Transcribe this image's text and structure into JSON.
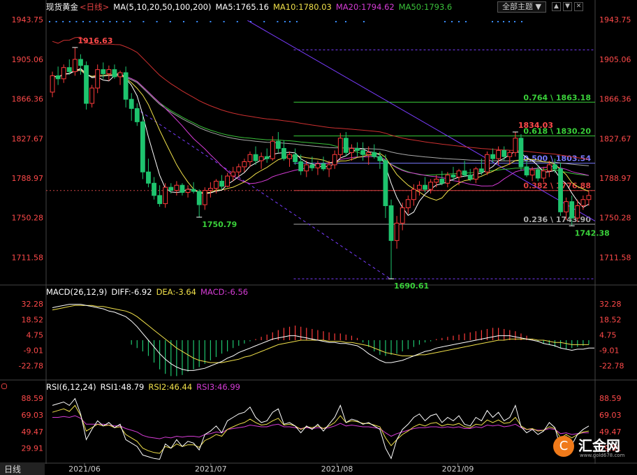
{
  "header": {
    "title": "现货黄金",
    "period": "<日线>",
    "ma_label": "MA(5,10,20,50,100,200)",
    "ma5": "MA5:1765.16",
    "ma10": "MA10:1780.03",
    "ma20": "MA20:1794.62",
    "ma50": "MA50:1793.6",
    "theme_button": "全部主题",
    "theme_arrow": "▼",
    "controls": [
      "▲",
      "▼",
      "✕"
    ]
  },
  "macd_header": {
    "label": "MACD(26,12,9)",
    "diff": "DIFF:-6.92",
    "dea": "DEA:-3.64",
    "macd": "MACD:-6.56"
  },
  "rsi_header": {
    "label": "RSI(6,12,24)",
    "rsi1": "RSI1:48.79",
    "rsi2": "RSI2:46.44",
    "rsi3": "RSI3:46.99"
  },
  "bottom_tab": "日线",
  "logo": {
    "text": "汇金网",
    "url": "www.gold678.com"
  },
  "colors": {
    "up": "#ff3b3b",
    "down": "#1ec46e",
    "ma5": "#ffffff",
    "ma10": "#f0e04a",
    "ma20": "#d63cd6",
    "ma50": "#3ac23a",
    "ma100": "#cc3030",
    "ma200": "#aaaaaa",
    "axis_text": "#ff4a4a",
    "trend": "#7a3cff"
  },
  "chart_data": [
    {
      "type": "candlestick",
      "title": "现货黄金 日线",
      "y_ticks": [
        "1943.75",
        "1905.06",
        "1866.36",
        "1827.67",
        "1788.97",
        "1750.28",
        "1711.58"
      ],
      "ylim": [
        1690,
        1948
      ],
      "x_ticks": [
        "2021/06",
        "2021/07",
        "2021/08",
        "2021/09"
      ],
      "candles": [
        [
          1873,
          1893,
          1868,
          1889
        ],
        [
          1889,
          1898,
          1880,
          1886
        ],
        [
          1886,
          1900,
          1882,
          1897
        ],
        [
          1897,
          1905,
          1890,
          1893
        ],
        [
          1893,
          1916.63,
          1889,
          1905
        ],
        [
          1905,
          1910,
          1890,
          1899
        ],
        [
          1899,
          1903,
          1856,
          1862
        ],
        [
          1862,
          1880,
          1858,
          1877
        ],
        [
          1877,
          1900,
          1872,
          1895
        ],
        [
          1895,
          1902,
          1886,
          1891
        ],
        [
          1891,
          1899,
          1884,
          1895
        ],
        [
          1895,
          1900,
          1886,
          1888
        ],
        [
          1888,
          1894,
          1880,
          1892
        ],
        [
          1892,
          1898,
          1858,
          1866
        ],
        [
          1866,
          1872,
          1845,
          1857
        ],
        [
          1857,
          1862,
          1840,
          1844
        ],
        [
          1844,
          1850,
          1788,
          1795
        ],
        [
          1795,
          1808,
          1780,
          1784
        ],
        [
          1784,
          1790,
          1768,
          1772
        ],
        [
          1772,
          1782,
          1761,
          1764
        ],
        [
          1764,
          1784,
          1760,
          1780
        ],
        [
          1780,
          1784,
          1774,
          1777
        ],
        [
          1777,
          1786,
          1772,
          1782
        ],
        [
          1782,
          1784,
          1772,
          1775
        ],
        [
          1775,
          1782,
          1770,
          1778
        ],
        [
          1778,
          1785,
          1774,
          1776
        ],
        [
          1776,
          1778,
          1750.79,
          1763
        ],
        [
          1763,
          1780,
          1758,
          1777
        ],
        [
          1777,
          1785,
          1770,
          1779
        ],
        [
          1779,
          1788,
          1774,
          1786
        ],
        [
          1786,
          1792,
          1778,
          1781
        ],
        [
          1781,
          1794,
          1780,
          1791
        ],
        [
          1791,
          1800,
          1786,
          1795
        ],
        [
          1795,
          1803,
          1790,
          1800
        ],
        [
          1800,
          1808,
          1795,
          1805
        ],
        [
          1805,
          1815,
          1800,
          1812
        ],
        [
          1812,
          1820,
          1802,
          1806
        ],
        [
          1806,
          1814,
          1798,
          1810
        ],
        [
          1810,
          1818,
          1804,
          1808
        ],
        [
          1808,
          1830,
          1806,
          1825
        ],
        [
          1825,
          1834,
          1814,
          1818
        ],
        [
          1818,
          1826,
          1806,
          1808
        ],
        [
          1808,
          1815,
          1800,
          1812
        ],
        [
          1812,
          1818,
          1802,
          1805
        ],
        [
          1805,
          1812,
          1792,
          1796
        ],
        [
          1796,
          1806,
          1790,
          1802
        ],
        [
          1802,
          1810,
          1796,
          1799
        ],
        [
          1799,
          1806,
          1792,
          1803
        ],
        [
          1803,
          1810,
          1796,
          1798
        ],
        [
          1798,
          1806,
          1790,
          1802
        ],
        [
          1802,
          1816,
          1798,
          1812
        ],
        [
          1812,
          1833,
          1808,
          1828
        ],
        [
          1828,
          1834,
          1810,
          1814
        ],
        [
          1814,
          1822,
          1806,
          1818
        ],
        [
          1818,
          1824,
          1810,
          1816
        ],
        [
          1816,
          1824,
          1806,
          1812
        ],
        [
          1812,
          1820,
          1802,
          1814
        ],
        [
          1814,
          1822,
          1808,
          1810
        ],
        [
          1810,
          1815,
          1798,
          1806
        ],
        [
          1806,
          1812,
          1750,
          1762
        ],
        [
          1762,
          1768,
          1690.61,
          1728
        ],
        [
          1728,
          1752,
          1720,
          1745
        ],
        [
          1745,
          1765,
          1738,
          1760
        ],
        [
          1760,
          1772,
          1754,
          1768
        ],
        [
          1768,
          1783,
          1762,
          1778
        ],
        [
          1778,
          1786,
          1772,
          1782
        ],
        [
          1782,
          1790,
          1775,
          1778
        ],
        [
          1778,
          1788,
          1774,
          1785
        ],
        [
          1785,
          1792,
          1780,
          1788
        ],
        [
          1788,
          1796,
          1782,
          1784
        ],
        [
          1784,
          1795,
          1780,
          1792
        ],
        [
          1792,
          1800,
          1786,
          1790
        ],
        [
          1790,
          1798,
          1782,
          1796
        ],
        [
          1796,
          1806,
          1790,
          1792
        ],
        [
          1792,
          1798,
          1786,
          1788
        ],
        [
          1788,
          1800,
          1784,
          1798
        ],
        [
          1798,
          1808,
          1792,
          1795
        ],
        [
          1795,
          1815,
          1792,
          1812
        ],
        [
          1812,
          1818,
          1804,
          1808
        ],
        [
          1808,
          1820,
          1802,
          1816
        ],
        [
          1816,
          1820,
          1806,
          1810
        ],
        [
          1810,
          1816,
          1802,
          1814
        ],
        [
          1814,
          1834.03,
          1810,
          1828
        ],
        [
          1828,
          1832,
          1796,
          1800
        ],
        [
          1800,
          1806,
          1790,
          1792
        ],
        [
          1792,
          1800,
          1786,
          1797
        ],
        [
          1797,
          1802,
          1786,
          1789
        ],
        [
          1789,
          1800,
          1785,
          1796
        ],
        [
          1796,
          1806,
          1790,
          1802
        ],
        [
          1802,
          1808,
          1794,
          1798
        ],
        [
          1798,
          1804,
          1752,
          1756
        ],
        [
          1756,
          1770,
          1748,
          1766
        ],
        [
          1766,
          1772,
          1742.38,
          1750
        ],
        [
          1750,
          1768,
          1746,
          1762
        ],
        [
          1762,
          1772,
          1758,
          1768
        ],
        [
          1768,
          1776,
          1762,
          1772
        ]
      ],
      "annotations": [
        "1916.63",
        "1750.79",
        "1690.61",
        "1834.03",
        "1742.38"
      ],
      "fibonacci": [
        {
          "label": "0.764 \\ 1863.18",
          "value": 1863.18,
          "color": "#3ad13a"
        },
        {
          "label": "0.618 \\ 1830.20",
          "value": 1830.2,
          "color": "#3ad13a"
        },
        {
          "label": "0.500 \\ 1803.54",
          "value": 1803.54,
          "color": "#7a7aff"
        },
        {
          "label": "0.382 \\ 1776.88",
          "value": 1776.88,
          "color": "#e04040"
        },
        {
          "label": "0.236 \\ 1743.90",
          "value": 1743.9,
          "color": "#aaaaaa"
        }
      ],
      "fib_extra_levels": [
        1914.3,
        1690.61
      ]
    },
    {
      "type": "macd",
      "y_ticks": [
        "32.28",
        "18.52",
        "4.75",
        "-9.01",
        "-22.78"
      ],
      "ylim": [
        -33,
        38
      ],
      "histogram": [
        0,
        0,
        0,
        0,
        0,
        0,
        0,
        0,
        0,
        0,
        0,
        0,
        0,
        0,
        -4,
        -7,
        -10,
        -14,
        -20,
        -26,
        -30,
        -32,
        -32,
        -31,
        -28,
        -26,
        -24,
        -21,
        -18,
        -15,
        -12,
        -10,
        -7,
        -5,
        -3,
        -1,
        1,
        3,
        5,
        7,
        9,
        11,
        12,
        13,
        12,
        11,
        10,
        9,
        8,
        7,
        6,
        6,
        5,
        4,
        2,
        -2,
        -6,
        -10,
        -13,
        -14,
        -13,
        -12,
        -10,
        -8,
        -6,
        -4,
        -2,
        -1,
        1,
        2,
        3,
        4,
        5,
        6,
        7,
        8,
        9,
        10,
        11,
        11,
        10,
        9,
        8,
        6,
        4,
        1,
        -1,
        -3,
        -4,
        -6,
        -7,
        -8,
        -7,
        -6,
        -5,
        -4
      ],
      "diff": [
        29,
        30,
        31,
        32,
        32,
        32,
        31,
        30,
        29,
        28,
        26,
        25,
        23,
        21,
        17,
        12,
        6,
        0,
        -6,
        -12,
        -17,
        -21,
        -24,
        -26,
        -27,
        -27,
        -26,
        -25,
        -23,
        -21,
        -19,
        -16,
        -14,
        -11,
        -9,
        -7,
        -5,
        -3,
        -1,
        1,
        2,
        3,
        4,
        4,
        3,
        2,
        1,
        0,
        -1,
        -2,
        -2,
        -3,
        -3,
        -4,
        -5,
        -8,
        -12,
        -15,
        -18,
        -20,
        -20,
        -19,
        -18,
        -16,
        -14,
        -12,
        -10,
        -9,
        -7,
        -6,
        -5,
        -4,
        -3,
        -2,
        -1,
        0,
        1,
        2,
        3,
        4,
        4,
        4,
        3,
        2,
        1,
        0,
        -1,
        -3,
        -4,
        -5,
        -7,
        -8,
        -9,
        -8,
        -8,
        -7,
        -7
      ],
      "dea": [
        27,
        28,
        29,
        30,
        31,
        31,
        31,
        31,
        30,
        30,
        29,
        28,
        27,
        26,
        24,
        21,
        17,
        13,
        9,
        5,
        1,
        -3,
        -7,
        -10,
        -13,
        -16,
        -18,
        -19,
        -20,
        -20,
        -20,
        -19,
        -18,
        -17,
        -15,
        -14,
        -12,
        -10,
        -8,
        -6,
        -4,
        -3,
        -2,
        -1,
        0,
        0,
        0,
        0,
        0,
        -1,
        -1,
        -1,
        -2,
        -2,
        -3,
        -4,
        -5,
        -7,
        -9,
        -11,
        -12,
        -13,
        -14,
        -14,
        -14,
        -13,
        -13,
        -12,
        -11,
        -10,
        -9,
        -8,
        -7,
        -6,
        -5,
        -4,
        -3,
        -2,
        -1,
        0,
        0,
        1,
        1,
        1,
        1,
        1,
        0,
        0,
        -1,
        -2,
        -2,
        -3,
        -4,
        -4,
        -4,
        -4
      ]
    },
    {
      "type": "rsi",
      "y_ticks": [
        "88.59",
        "69.03",
        "49.47",
        "29.91"
      ],
      "ylim": [
        15,
        95
      ],
      "rsi1": [
        80,
        82,
        84,
        80,
        88,
        70,
        40,
        52,
        62,
        56,
        60,
        54,
        58,
        40,
        36,
        32,
        22,
        20,
        18,
        17,
        35,
        30,
        40,
        32,
        38,
        36,
        28,
        46,
        50,
        56,
        48,
        62,
        66,
        70,
        72,
        78,
        66,
        60,
        62,
        72,
        76,
        58,
        60,
        56,
        48,
        56,
        52,
        58,
        50,
        58,
        66,
        80,
        60,
        64,
        62,
        58,
        60,
        56,
        52,
        30,
        18,
        40,
        52,
        58,
        66,
        70,
        62,
        68,
        70,
        60,
        66,
        62,
        68,
        58,
        56,
        66,
        62,
        74,
        66,
        72,
        62,
        66,
        80,
        55,
        48,
        52,
        46,
        50,
        60,
        54,
        30,
        44,
        34,
        46,
        52,
        56
      ],
      "rsi2": [
        72,
        74,
        76,
        73,
        80,
        68,
        50,
        54,
        58,
        56,
        57,
        54,
        55,
        46,
        42,
        38,
        30,
        27,
        25,
        24,
        32,
        30,
        35,
        32,
        34,
        34,
        31,
        39,
        42,
        46,
        44,
        52,
        55,
        58,
        60,
        64,
        60,
        57,
        58,
        62,
        65,
        57,
        58,
        56,
        52,
        55,
        54,
        56,
        53,
        56,
        60,
        68,
        60,
        62,
        61,
        59,
        59,
        57,
        55,
        42,
        33,
        40,
        46,
        50,
        55,
        58,
        56,
        59,
        60,
        56,
        58,
        57,
        59,
        55,
        54,
        58,
        57,
        63,
        60,
        63,
        59,
        60,
        66,
        56,
        52,
        53,
        50,
        51,
        55,
        53,
        42,
        46,
        42,
        46,
        49,
        50
      ],
      "rsi3": [
        66,
        66,
        67,
        66,
        68,
        65,
        58,
        58,
        58,
        58,
        57,
        56,
        56,
        53,
        51,
        49,
        45,
        43,
        42,
        41,
        43,
        42,
        44,
        43,
        44,
        44,
        43,
        46,
        47,
        49,
        48,
        52,
        53,
        54,
        55,
        57,
        56,
        55,
        55,
        57,
        58,
        55,
        55,
        54,
        53,
        54,
        53,
        54,
        53,
        54,
        56,
        59,
        56,
        57,
        56,
        55,
        55,
        54,
        53,
        48,
        44,
        47,
        49,
        51,
        53,
        54,
        54,
        55,
        55,
        54,
        55,
        54,
        55,
        53,
        53,
        55,
        54,
        57,
        56,
        57,
        55,
        56,
        58,
        54,
        52,
        52,
        51,
        51,
        53,
        52,
        47,
        48,
        46,
        47,
        48,
        48
      ]
    }
  ]
}
